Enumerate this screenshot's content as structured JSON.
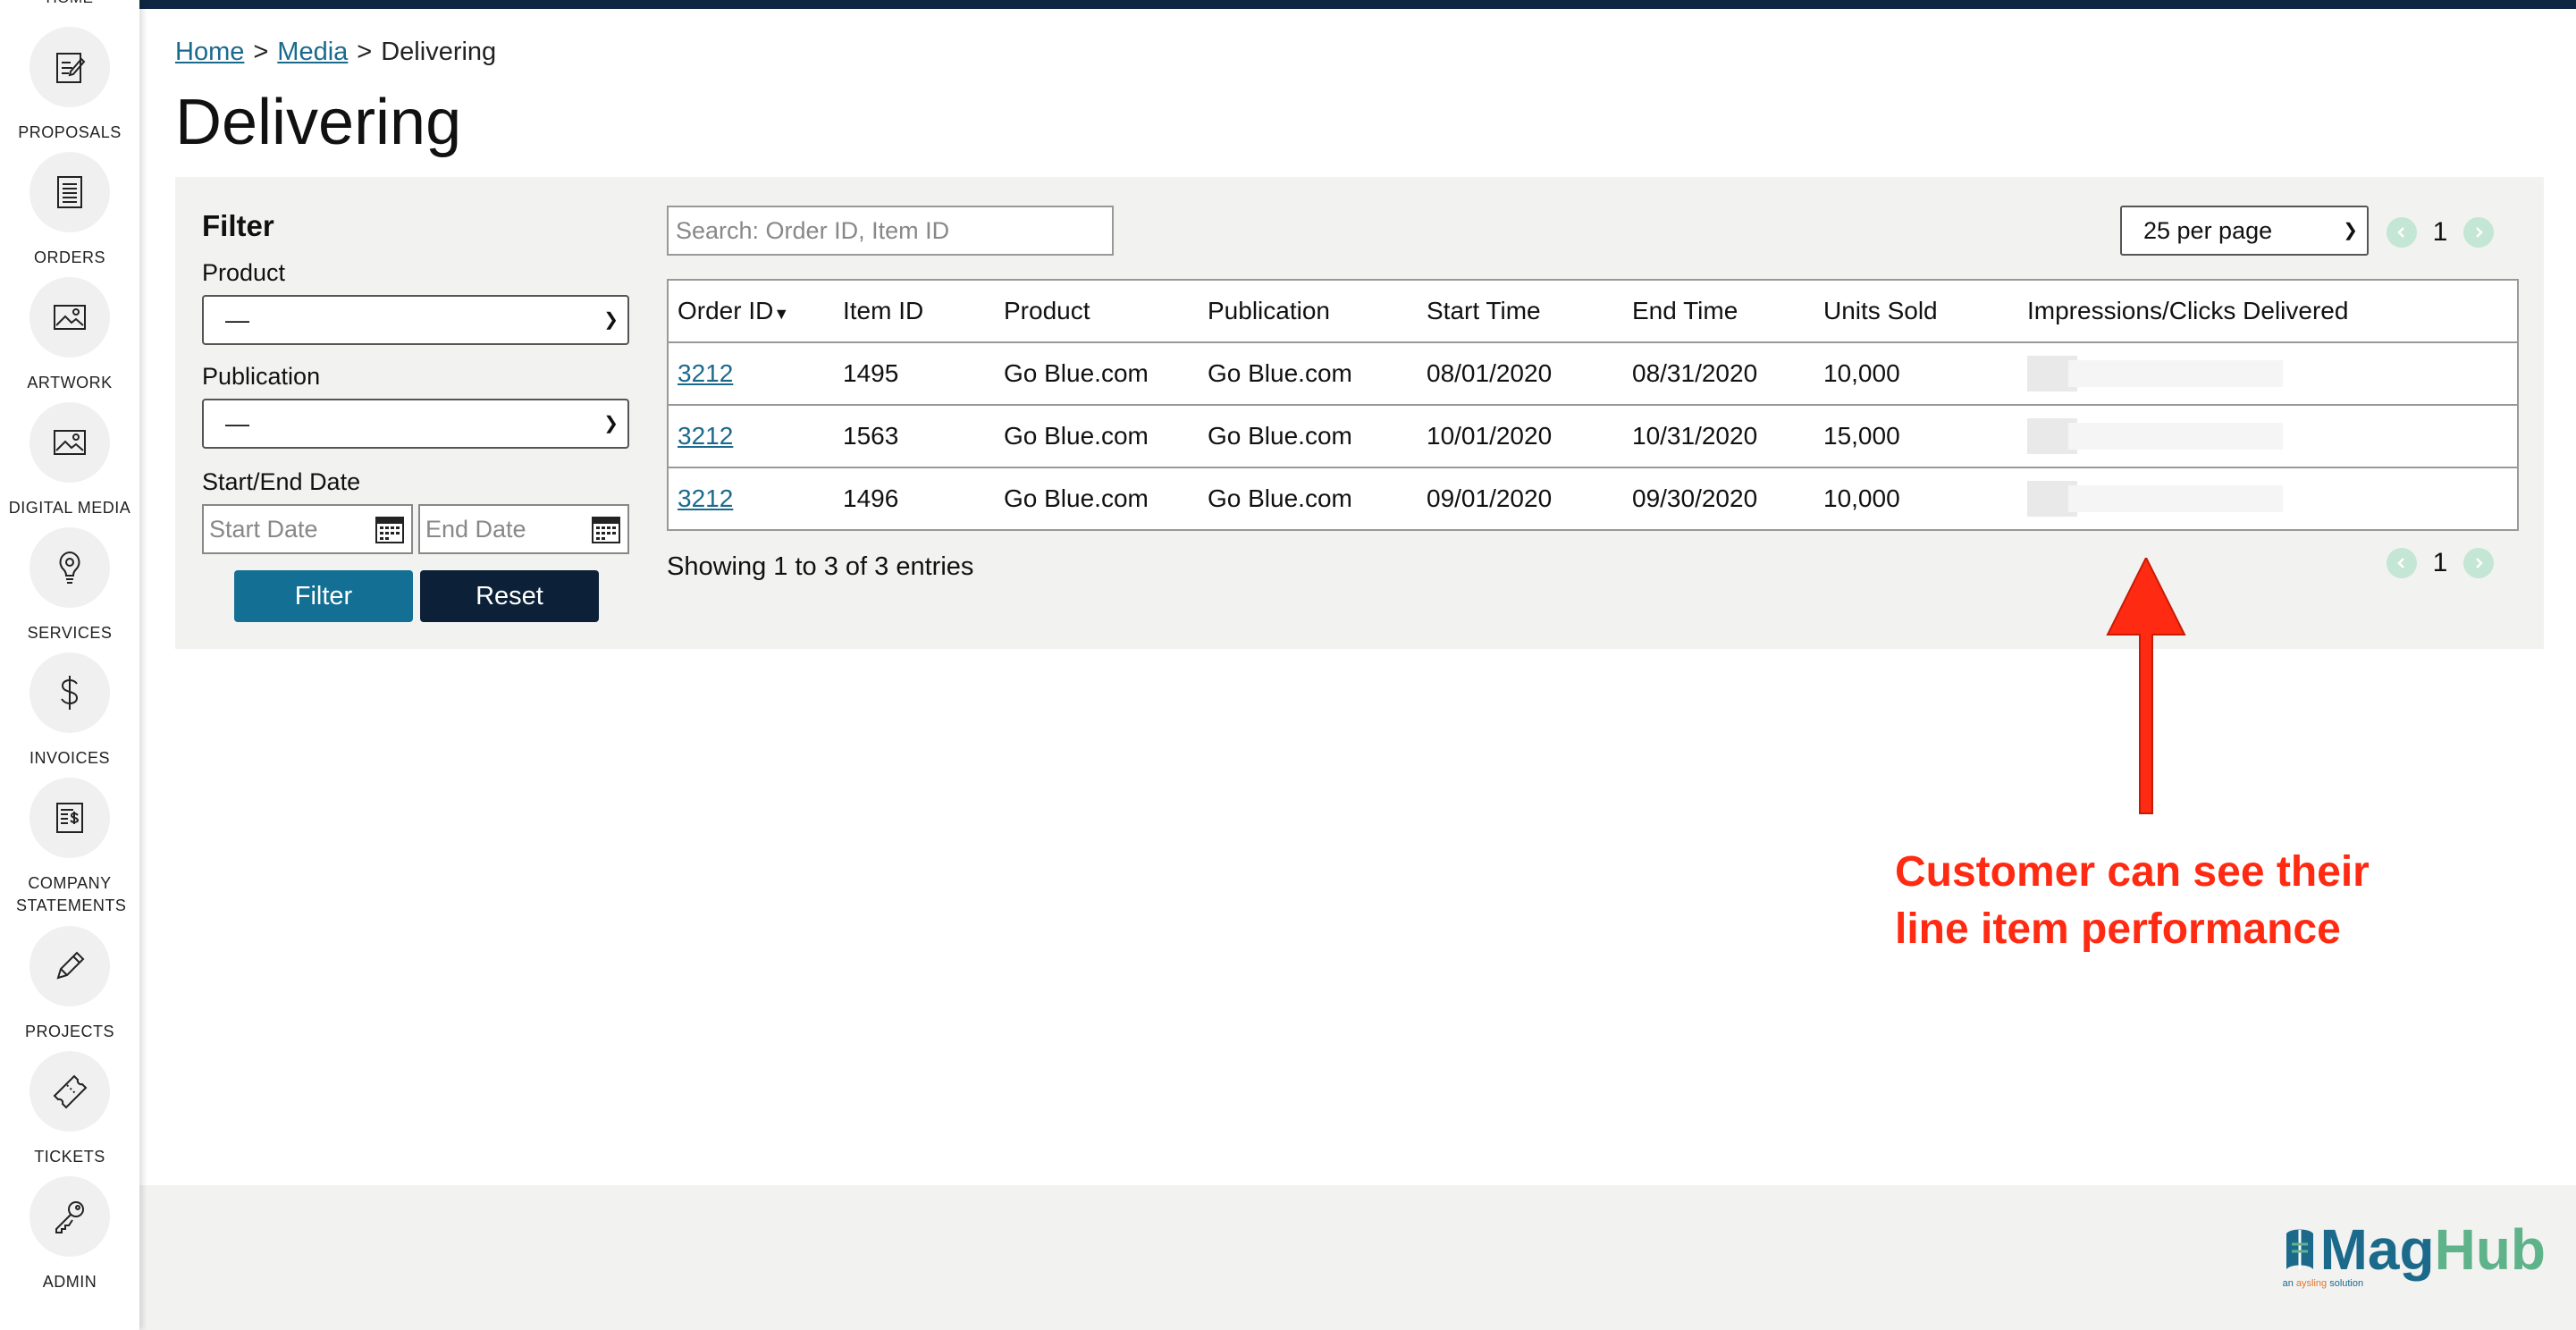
{
  "sidebar": {
    "partial_label": "HOME",
    "items": [
      {
        "label": "PROPOSALS",
        "icon": "proposals-icon"
      },
      {
        "label": "ORDERS",
        "icon": "orders-icon"
      },
      {
        "label": "ARTWORK",
        "icon": "artwork-icon"
      },
      {
        "label": "DIGITAL MEDIA",
        "icon": "digital-media-icon"
      },
      {
        "label": "SERVICES",
        "icon": "services-icon"
      },
      {
        "label": "INVOICES",
        "icon": "dollar-icon"
      },
      {
        "label": "COMPANY STATEMENTS",
        "icon": "statements-icon"
      },
      {
        "label": "PROJECTS",
        "icon": "pencil-icon"
      },
      {
        "label": "TICKETS",
        "icon": "ticket-icon"
      },
      {
        "label": "ADMIN",
        "icon": "key-icon"
      }
    ]
  },
  "breadcrumb": {
    "home": "Home",
    "media": "Media",
    "sep": ">",
    "current": "Delivering"
  },
  "page_title": "Delivering",
  "filter": {
    "title": "Filter",
    "product_label": "Product",
    "product_value": "—",
    "publication_label": "Publication",
    "publication_value": "—",
    "date_label": "Start/End Date",
    "start_placeholder": "Start Date",
    "end_placeholder": "End Date",
    "filter_button": "Filter",
    "reset_button": "Reset"
  },
  "table_controls": {
    "search_placeholder": "Search: Order ID, Item ID",
    "per_page": "25 per page",
    "page": "1",
    "showing": "Showing 1 to 3 of 3 entries"
  },
  "table": {
    "headers": [
      "Order ID",
      "Item ID",
      "Product",
      "Publication",
      "Start Time",
      "End Time",
      "Units Sold",
      "Impressions/Clicks Delivered"
    ],
    "rows": [
      {
        "order_id": "3212",
        "item_id": "1495",
        "product": "Go Blue.com",
        "publication": "Go Blue.com",
        "start": "08/01/2020",
        "end": "08/31/2020",
        "units": "10,000"
      },
      {
        "order_id": "3212",
        "item_id": "1563",
        "product": "Go Blue.com",
        "publication": "Go Blue.com",
        "start": "10/01/2020",
        "end": "10/31/2020",
        "units": "15,000"
      },
      {
        "order_id": "3212",
        "item_id": "1496",
        "product": "Go Blue.com",
        "publication": "Go Blue.com",
        "start": "09/01/2020",
        "end": "09/30/2020",
        "units": "10,000"
      }
    ]
  },
  "annotation": {
    "line1": "Customer can see their",
    "line2": "line item performance",
    "color": "#ff2a12"
  },
  "footer": {
    "logo_mag": "Mag",
    "logo_hub": "Hub",
    "logo_sub_pre": "an ",
    "logo_sub_brand": "aysling",
    "logo_sub_post": " solution"
  },
  "colors": {
    "accent": "#146f94",
    "dark": "#0c2037",
    "link": "#1b6a8c",
    "topbar": "#0f2743"
  }
}
